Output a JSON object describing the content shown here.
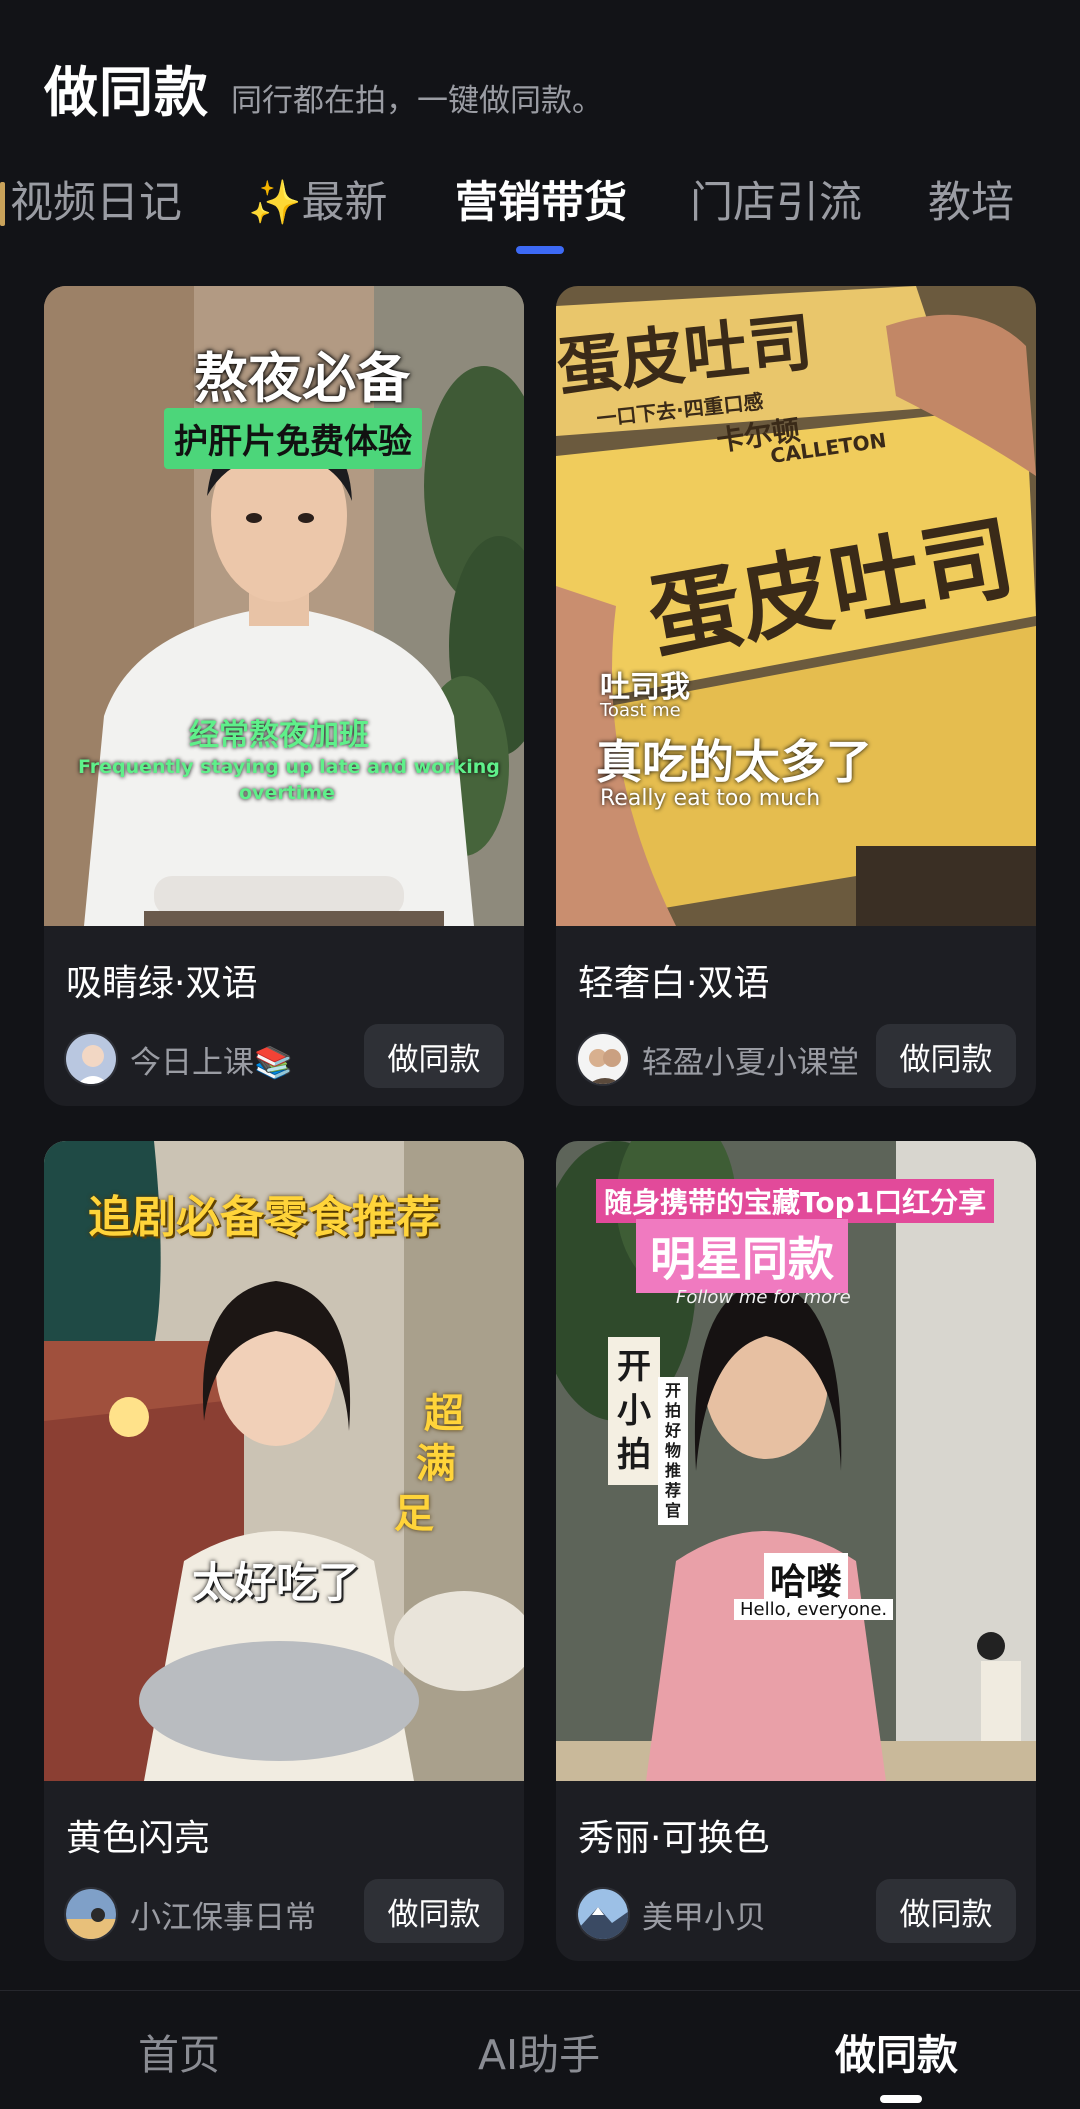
{
  "header": {
    "title": "做同款",
    "subtitle": "同行都在拍，一键做同款。"
  },
  "tabs": [
    {
      "label": "视频日记"
    },
    {
      "label": "✨最新"
    },
    {
      "label": "营销带货"
    },
    {
      "label": "门店引流"
    },
    {
      "label": "教培"
    }
  ],
  "active_tab": "营销带货",
  "cards": [
    {
      "title": "吸睛绿·双语",
      "author": "今日上课📚",
      "button": "做同款",
      "overlay": {
        "headline": "熬夜必备",
        "tag": "护肝片免费体验",
        "caption_cn": "经常熬夜加班",
        "caption_en_1": "Frequently staying up late and working",
        "caption_en_2": "overtime"
      }
    },
    {
      "title": "轻奢白·双语",
      "author": "轻盈小夏小课堂",
      "button": "做同款",
      "overlay": {
        "pack_top": "蛋皮吐司",
        "brand_cn": "卡尔顿",
        "brand_en": "CALLETON",
        "pack_sub": "一口下去·四重口感",
        "pack_big": "蛋皮吐司",
        "small_cn": "吐司我",
        "small_en": "Toast me",
        "caption_cn": "真吃的太多了",
        "caption_en": "Really eat too much"
      }
    },
    {
      "title": "黄色闪亮",
      "author": "小江保事日常",
      "button": "做同款",
      "overlay": {
        "headline": "追剧必备零食推荐",
        "side_1": "超",
        "side_2": "满",
        "side_3": "足",
        "caption": "太好吃了"
      }
    },
    {
      "title": "秀丽·可换色",
      "author": "美甲小贝",
      "button": "做同款",
      "overlay": {
        "banner": "随身携带的宝藏Top1口红分享",
        "headline": "明星同款",
        "follow": "Follow me for more",
        "badge_big": "开小拍",
        "badge_small": "开拍好物推荐官",
        "caption_cn": "哈喽",
        "caption_en": "Hello, everyone."
      }
    }
  ],
  "bottom_nav": [
    {
      "label": "首页"
    },
    {
      "label": "AI助手"
    },
    {
      "label": "做同款"
    }
  ],
  "colors": {
    "background": "#121317",
    "card": "#1d1e23",
    "accent": "#3d6af5",
    "muted_text": "#9a9ca3",
    "button_bg": "#2e3036"
  }
}
